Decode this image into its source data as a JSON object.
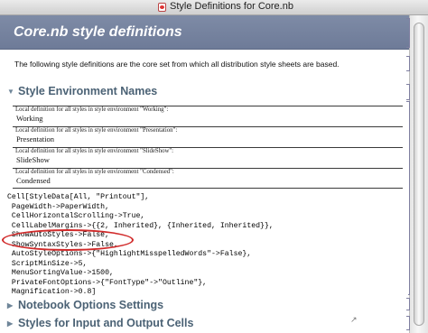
{
  "window": {
    "title": "Style Definitions for Core.nb"
  },
  "header": {
    "heading": "Core.nb  style definitions"
  },
  "intro": "The following style definitions are the core set from which all distribution style sheets are based.",
  "sections": {
    "environment_names": "Style Environment Names",
    "notebook_options": "Notebook Options Settings",
    "input_output": "Styles for Input and Output Cells"
  },
  "environments": [
    {
      "caption": "Local definition for all styles in style environment \"Working\":",
      "name": "Working"
    },
    {
      "caption": "Local definition for all styles in style environment \"Presentation\":",
      "name": "Presentation"
    },
    {
      "caption": "Local definition for all styles in style environment \"SlideShow\":",
      "name": "SlideShow"
    },
    {
      "caption": "Local definition for all styles in style environment \"Condensed\":",
      "name": "Condensed"
    }
  ],
  "code_lines": [
    "Cell[StyleData[All, \"Printout\"],",
    " PageWidth->PaperWidth,",
    " CellHorizontalScrolling->True,",
    " CellLabelMargins->{{2, Inherited}, {Inherited, Inherited}},",
    " ShowAutoStyles->False,",
    " ShowSyntaxStyles->False,",
    " AutoStyleOptions->{\"HighlightMisspelledWords\"->False},",
    " ScriptMinSize->5,",
    " MenuSortingValue->1500,",
    " PrivateFontOptions->{\"FontType\"->\"Outline\"},",
    " Magnification->0.8]"
  ],
  "colors": {
    "header_bg": "#7483a0",
    "section_text": "#4b6275",
    "highlight_ring": "#d12a2a"
  },
  "icons": {
    "title_doc": "notebook-doc-icon",
    "section_expanded": "triangle-down-icon",
    "section_collapsed": "triangle-right-icon"
  }
}
